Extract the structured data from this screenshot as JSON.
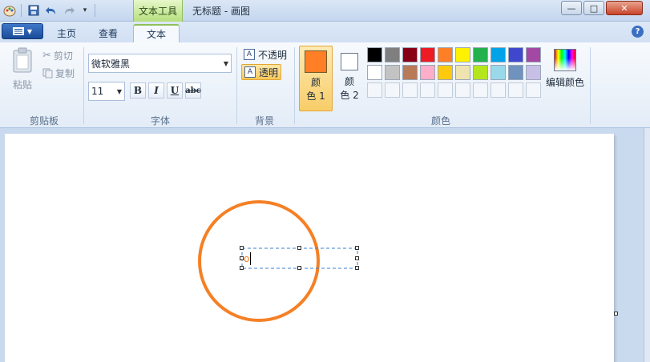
{
  "window": {
    "title": "无标题 - 画图",
    "context_tab": "文本工具",
    "minimize": "—",
    "maximize": "□",
    "close": "✕"
  },
  "tabs": [
    {
      "label": "主页"
    },
    {
      "label": "查看"
    },
    {
      "label": "文本",
      "active": true
    }
  ],
  "help_label": "?",
  "clipboard": {
    "group_label": "剪贴板",
    "paste_label": "粘贴",
    "cut_label": "剪切",
    "copy_label": "复制"
  },
  "font": {
    "group_label": "字体",
    "font_name": "微软雅黑",
    "font_size": "11",
    "bold_label": "B",
    "italic_label": "I",
    "underline_label": "U",
    "strike_label": "abc"
  },
  "background": {
    "group_label": "背景",
    "opaque_label": "不透明",
    "transparent_label": "透明",
    "selected": "transparent"
  },
  "colors": {
    "group_label": "颜色",
    "color1_label_top": "颜",
    "color1_label_bottom": "色 1",
    "color2_label_top": "颜",
    "color2_label_bottom": "色 2",
    "color1_value": "#ff7f27",
    "color2_value": "#ffffff",
    "edit_label": "编辑颜色",
    "palette_row1": [
      "#000000",
      "#7f7f7f",
      "#880015",
      "#ed1c24",
      "#ff7f27",
      "#fff200",
      "#22b14c",
      "#00a2e8",
      "#3f48cc",
      "#a349a4"
    ],
    "palette_row2": [
      "#ffffff",
      "#c3c3c3",
      "#b97a57",
      "#ffaec9",
      "#ffc90e",
      "#efe4b0",
      "#b5e61d",
      "#99d9ea",
      "#7092be",
      "#c8bfe7"
    ]
  },
  "canvas": {
    "text_entry": "o",
    "shape_color": "#f58025"
  }
}
